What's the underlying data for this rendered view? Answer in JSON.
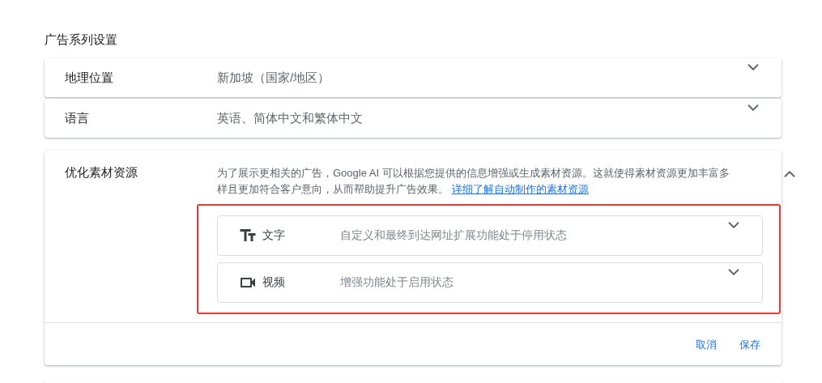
{
  "section_title": "广告系列设置",
  "settings": [
    {
      "label": "地理位置",
      "value": "新加坡（国家/地区）",
      "expanded": false
    },
    {
      "label": "语言",
      "value": "英语、简体中文和繁体中文",
      "expanded": false
    }
  ],
  "asset_optimization": {
    "label": "优化素材资源",
    "expanded": true,
    "description": "为了展示更相关的广告，Google AI 可以根据您提供的信息增强或生成素材资源。这就使得素材资源更加丰富多样且更加符合客户意向，从而帮助提升广告效果。",
    "link": "详细了解自动制作的素材资源",
    "options": [
      {
        "kind": "text",
        "label": "文字",
        "status": "自定义和最终到达网址扩展功能处于停用状态",
        "expanded": false
      },
      {
        "kind": "video",
        "label": "视频",
        "status": "增强功能处于启用状态",
        "expanded": false
      }
    ],
    "buttons": [
      "取消",
      "保存"
    ]
  }
}
